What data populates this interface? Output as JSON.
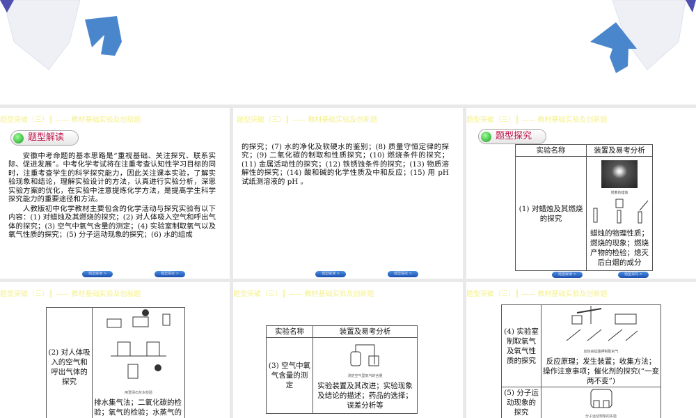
{
  "header": "题型突破（三）║ —— 教材基础实验及创新题",
  "nav": {
    "prev": "题型解读 >",
    "next": "题型探究 >"
  },
  "slide1": {
    "badge": "题型解读",
    "p1": "安徽中考命题的基本思路是“重视基础、关注探究、联系实际、促进发展”。中考化学考试将在注重考查认知性学习目标的同时，注重考查学生的科学探究能力，因此关注课本实验，了解实验现象和结论，理解实验设计的方法，认真进行实验分析，深思实验方案的优化，在实验中注意提炼化学方法，是提高学生科学探究能力的重要途径和方法。",
    "p2": "人教版初中化学教材主要包含的化学活动与探究实验有以下内容：(1) 对蜡烛及其燃烧的探究；(2) 对人体吸入空气和呼出气体的探究；(3) 空气中氧气含量的测定；(4) 实验室制取氧气以及氧气性质的探究；(5) 分子运动现象的探究；(6) 水的组成"
  },
  "slide2": {
    "p": "的探究；(7) 水的净化及软硬水的鉴别；(8) 质量守恒定律的探究；(9) 二氧化碳的制取和性质探究；(10) 燃烧条件的探究；(11) 金属活动性的探究；(12) 铁锈蚀条件的探究；(13) 物质溶解性的探究；(14) 酸和碱的化学性质及中和反应；(15) 用 pH 试纸测溶液的 pH 。"
  },
  "slide3": {
    "badge": "题型探究",
    "col1": "实验名称",
    "col2": "装置及易考分析",
    "name": "(1) 对蜡烛及其燃烧的探究",
    "caption": "燃着的蜡烛",
    "analysis": "蜡烛的物理性质；燃烧的现象；燃烧产物的检验；熄灭后白烟的成分"
  },
  "slide4": {
    "name": "(2) 对人体吸入的空气和呼出气体的探究",
    "caption": "用澄清石灰水检验",
    "analysis": "排水集气法；二氧化碳的检验；氧气的检验；水蒸气的"
  },
  "slide5": {
    "col1": "实验名称",
    "col2": "装置及易考分析",
    "name": "(3) 空气中氧气含量的测定",
    "caption": "测定空气里氧气的含量",
    "analysis": "实验装置及其改进；实验现象及结论的描述；药品的选择；误差分析等"
  },
  "slide6": {
    "name4": "(4) 实验室制取氧气及氧气性质的探究",
    "caption4": "加热高锰酸钾制取氧气",
    "analysis4": "反应原理；发生装置；收集方法；操作注意事项；催化剂的探究(“一变两不变”)",
    "name5": "(5) 分子运动现象的探究",
    "caption5": "分子运动现象的实验"
  }
}
